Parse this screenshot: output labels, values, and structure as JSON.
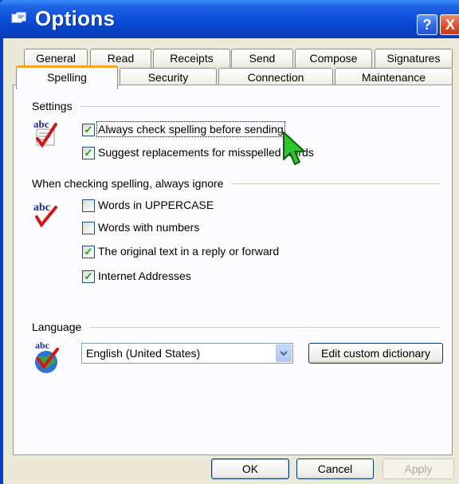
{
  "window": {
    "title": "Options",
    "help_label": "?",
    "close_label": "X"
  },
  "tabs_row1": [
    "General",
    "Read",
    "Receipts",
    "Send",
    "Compose",
    "Signatures"
  ],
  "tabs_row2": [
    "Spelling",
    "Security",
    "Connection",
    "Maintenance"
  ],
  "active_tab": "Spelling",
  "settings": {
    "label": "Settings",
    "options": [
      {
        "label": "Always check spelling before sending",
        "checked": true
      },
      {
        "label": "Suggest replacements for misspelled words",
        "checked": true
      }
    ]
  },
  "ignore": {
    "label": "When checking spelling, always ignore",
    "options": [
      {
        "label": "Words in UPPERCASE",
        "checked": false
      },
      {
        "label": "Words with numbers",
        "checked": false
      },
      {
        "label": "The original text in a reply or forward",
        "checked": true
      },
      {
        "label": "Internet Addresses",
        "checked": true
      }
    ]
  },
  "language": {
    "label": "Language",
    "selected": "English (United States)",
    "edit_button": "Edit custom dictionary"
  },
  "footer": {
    "ok": "OK",
    "cancel": "Cancel",
    "apply": "Apply"
  },
  "icons": {
    "title": "options-icon",
    "spell": "abc-spelling-icon",
    "globe": "globe-spelling-icon",
    "cursor": "mouse-cursor-icon"
  },
  "colors": {
    "title_bar": "#0a4fd9",
    "active_tab_accent": "#f0a52b",
    "check": "#21a121",
    "panel": "#fcfcfe"
  }
}
